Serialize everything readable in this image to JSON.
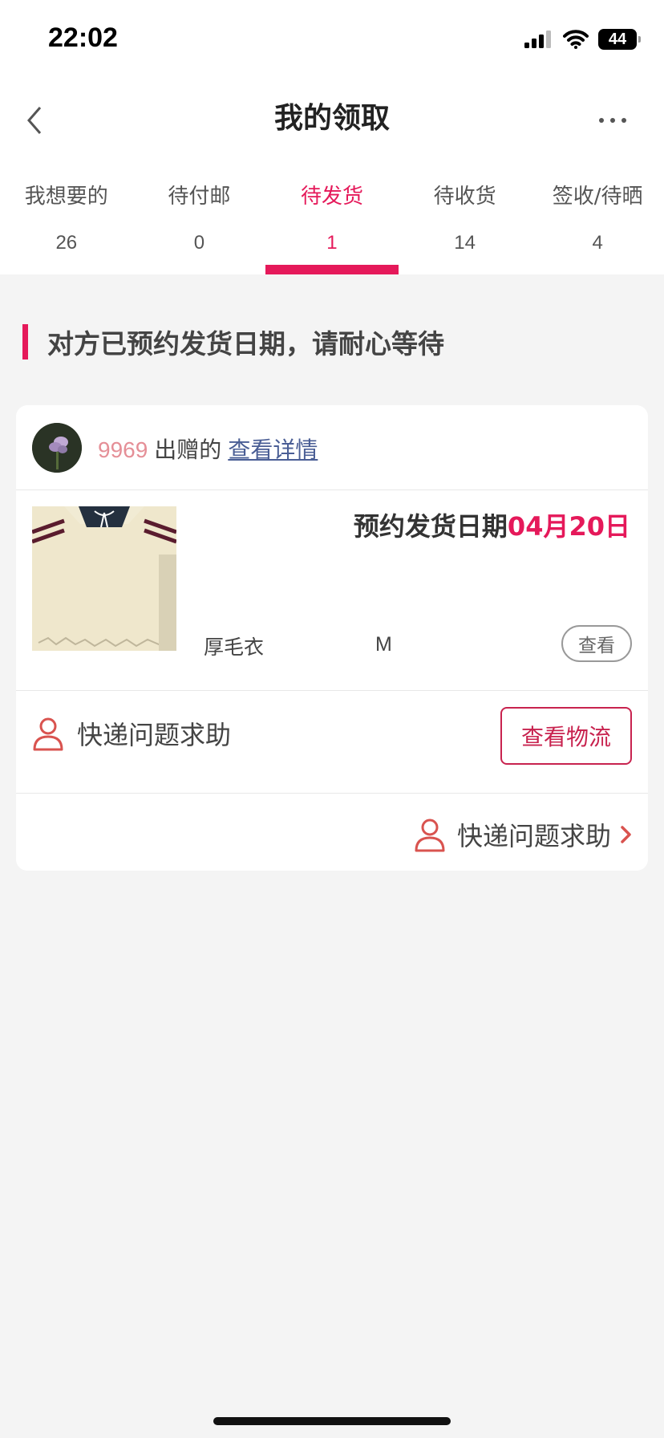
{
  "status_bar": {
    "time": "22:02",
    "battery_level": "44",
    "icons": [
      "cellular-signal-icon",
      "wifi-icon",
      "battery-icon"
    ]
  },
  "nav": {
    "title": "我的领取",
    "back_icon": "chevron-left-icon",
    "more_icon": "more-icon"
  },
  "tabs": [
    {
      "label": "我想要的",
      "count": "26",
      "active": false
    },
    {
      "label": "待付邮",
      "count": "0",
      "active": false
    },
    {
      "label": "待发货",
      "count": "1",
      "active": true
    },
    {
      "label": "待收货",
      "count": "14",
      "active": false
    },
    {
      "label": "签收/待晒",
      "count": "4",
      "active": false
    }
  ],
  "notice": {
    "text": "对方已预约发货日期，请耐心等待"
  },
  "order": {
    "donor_name": "9969",
    "donor_suffix": "出赠的",
    "detail_link": "查看详情",
    "ship_date_label": "预约发货日期",
    "ship_date_value": "04月20日",
    "product_name": "厚毛衣",
    "product_size": "M",
    "view_button": "查看",
    "help_text": "快递问题求助",
    "logistics_button": "查看物流",
    "footer_help_text": "快递问题求助"
  },
  "colors": {
    "accent": "#e5195a",
    "link": "#4a5e95",
    "donor_name": "#e58f97",
    "background": "#f4f4f4"
  }
}
